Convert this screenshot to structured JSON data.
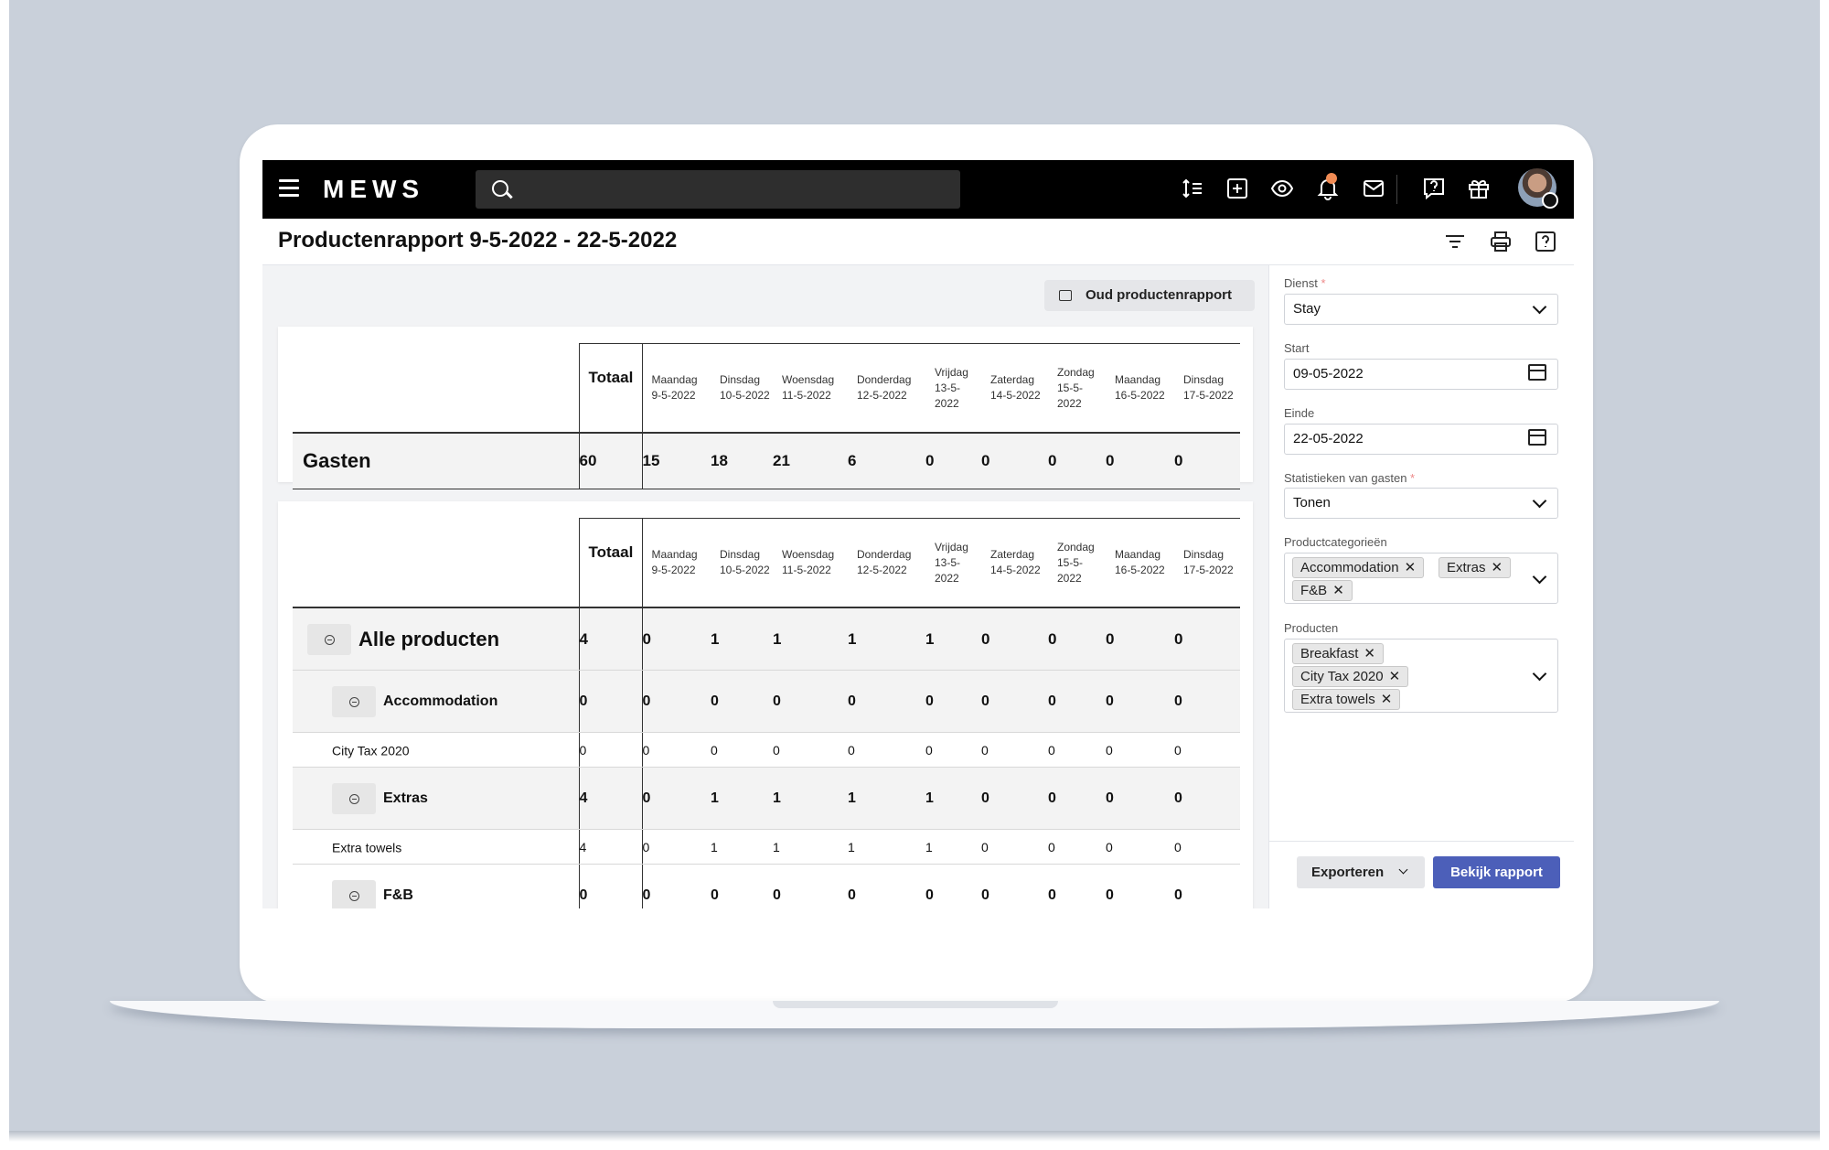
{
  "app": {
    "logo": "MEWS"
  },
  "search": {
    "placeholder": ""
  },
  "title": "Productenrapport 9-5-2022 - 22-5-2022",
  "toolbar": {
    "icons": [
      "sort-icon",
      "add-icon",
      "eye-icon",
      "bell-icon",
      "mail-icon",
      "help-chat-icon",
      "gift-icon"
    ],
    "notification_dot_color": "#f08b54"
  },
  "header_icons": [
    "filter-icon",
    "print-icon",
    "help-icon"
  ],
  "old_report_button": "Oud productenrapport",
  "days": [
    {
      "name": "Maandag",
      "date": "9-5-2022"
    },
    {
      "name": "Dinsdag",
      "date": "10-5-2022"
    },
    {
      "name": "Woensdag",
      "date": "11-5-2022"
    },
    {
      "name": "Donderdag",
      "date": "12-5-2022"
    },
    {
      "name": "Vrijdag",
      "date": "13-5-2022"
    },
    {
      "name": "Zaterdag",
      "date": "14-5-2022"
    },
    {
      "name": "Zondag",
      "date": "15-5-2022"
    },
    {
      "name": "Maandag",
      "date": "16-5-2022"
    },
    {
      "name": "Dinsdag",
      "date": "17-5-2022"
    }
  ],
  "total_label": "Totaal",
  "guests_table": {
    "label": "Gasten",
    "total": "60",
    "values": [
      "15",
      "18",
      "21",
      "6",
      "0",
      "0",
      "0",
      "0",
      "0"
    ]
  },
  "products_table": {
    "rows": [
      {
        "kind": "grp0",
        "label": "Alle producten",
        "total": "4",
        "values": [
          "0",
          "1",
          "1",
          "1",
          "1",
          "0",
          "0",
          "0",
          "0"
        ]
      },
      {
        "kind": "grp1",
        "label": "Accommodation",
        "total": "0",
        "values": [
          "0",
          "0",
          "0",
          "0",
          "0",
          "0",
          "0",
          "0",
          "0"
        ]
      },
      {
        "kind": "item",
        "label": "City Tax 2020",
        "total": "0",
        "values": [
          "0",
          "0",
          "0",
          "0",
          "0",
          "0",
          "0",
          "0",
          "0"
        ]
      },
      {
        "kind": "grp1",
        "label": "Extras",
        "total": "4",
        "values": [
          "0",
          "1",
          "1",
          "1",
          "1",
          "0",
          "0",
          "0",
          "0"
        ]
      },
      {
        "kind": "item",
        "label": "Extra towels",
        "total": "4",
        "values": [
          "0",
          "1",
          "1",
          "1",
          "1",
          "0",
          "0",
          "0",
          "0"
        ]
      },
      {
        "kind": "grp2",
        "label": "F&B",
        "total": "0",
        "values": [
          "0",
          "0",
          "0",
          "0",
          "0",
          "0",
          "0",
          "0",
          "0"
        ]
      }
    ]
  },
  "filters": {
    "dienst": {
      "label": "Dienst",
      "required": "*",
      "value": "Stay"
    },
    "start": {
      "label": "Start",
      "value": "09-05-2022"
    },
    "einde": {
      "label": "Einde",
      "value": "22-05-2022"
    },
    "stats": {
      "label": "Statistieken van gasten",
      "required": "*",
      "value": "Tonen"
    },
    "categories": {
      "label": "Productcategorieën",
      "chips": [
        "Accommodation",
        "Extras",
        "F&B"
      ]
    },
    "products": {
      "label": "Producten",
      "chips": [
        "Breakfast",
        "City Tax 2020",
        "Extra towels"
      ]
    },
    "chip_remove": "✕"
  },
  "footer": {
    "export_label": "Exporteren",
    "view_label": "Bekijk rapport"
  },
  "colors": {
    "topbar": "#000000",
    "primary_button": "#4c5fb9",
    "background": "#c9d0da"
  }
}
